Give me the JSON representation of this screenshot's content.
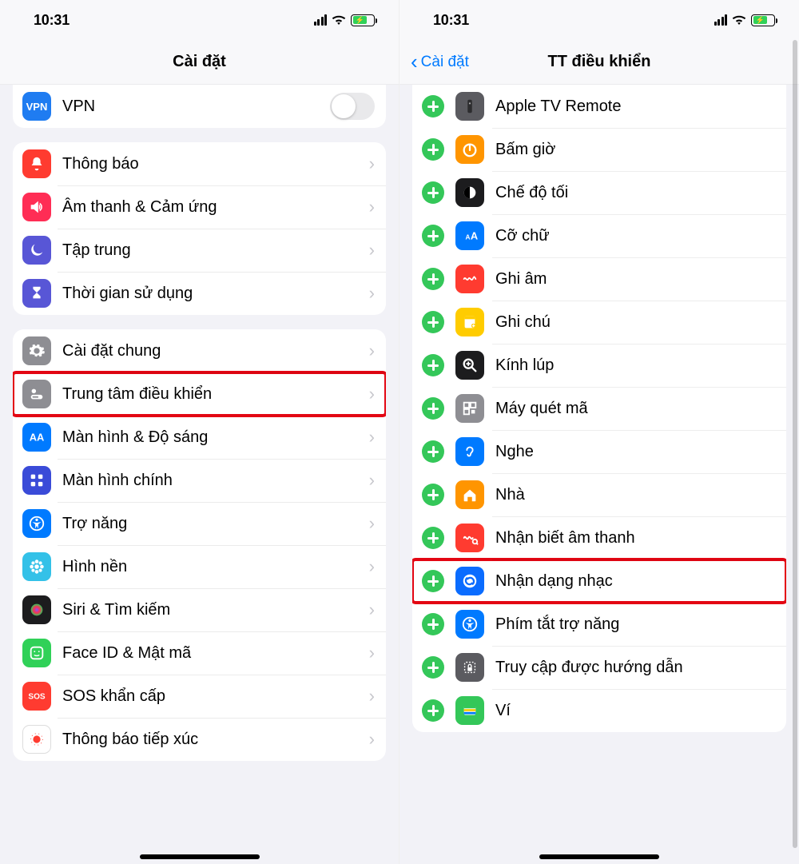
{
  "status": {
    "time": "10:31"
  },
  "left": {
    "title": "Cài đặt",
    "vpn": {
      "label": "VPN",
      "icon_bg": "#1f7cf1",
      "icon_text": "VPN"
    },
    "group2": [
      {
        "label": "Thông báo",
        "icon_bg": "#ff3b30",
        "icon": "bell"
      },
      {
        "label": "Âm thanh & Cảm ứng",
        "icon_bg": "#ff2d55",
        "icon": "speaker"
      },
      {
        "label": "Tập trung",
        "icon_bg": "#5856d6",
        "icon": "moon"
      },
      {
        "label": "Thời gian sử dụng",
        "icon_bg": "#5856d6",
        "icon": "hourglass"
      }
    ],
    "group3": [
      {
        "label": "Cài đặt chung",
        "icon_bg": "#8e8e93",
        "icon": "gear"
      },
      {
        "label": "Trung tâm điều khiển",
        "icon_bg": "#8e8e93",
        "icon": "switches",
        "highlight": true
      },
      {
        "label": "Màn hình & Độ sáng",
        "icon_bg": "#007aff",
        "icon": "aa"
      },
      {
        "label": "Màn hình chính",
        "icon_bg": "#3a4bd8",
        "icon": "gridapps"
      },
      {
        "label": "Trợ năng",
        "icon_bg": "#007aff",
        "icon": "accessibility"
      },
      {
        "label": "Hình nền",
        "icon_bg": "#33c1e8",
        "icon": "flower"
      },
      {
        "label": "Siri & Tìm kiếm",
        "icon_bg": "#1c1c1e",
        "icon": "siri"
      },
      {
        "label": "Face ID & Mật mã",
        "icon_bg": "#30d158",
        "icon": "faceid"
      },
      {
        "label": "SOS khẩn cấp",
        "icon_bg": "#ff3b30",
        "icon": "sos"
      },
      {
        "label": "Thông báo tiếp xúc",
        "icon_bg": "#ffffff",
        "icon": "exposure"
      }
    ]
  },
  "right": {
    "back_label": "Cài đặt",
    "title": "TT điều khiển",
    "controls": [
      {
        "label": "Apple TV Remote",
        "icon_bg": "#5b5b60",
        "icon": "remote"
      },
      {
        "label": "Bấm giờ",
        "icon_bg": "#ff9500",
        "icon": "timer"
      },
      {
        "label": "Chế độ tối",
        "icon_bg": "#1c1c1e",
        "icon": "darkmode"
      },
      {
        "label": "Cỡ chữ",
        "icon_bg": "#007aff",
        "icon": "aA"
      },
      {
        "label": "Ghi âm",
        "icon_bg": "#ff3b30",
        "icon": "voicememo"
      },
      {
        "label": "Ghi chú",
        "icon_bg": "#ffcc00",
        "icon": "notes"
      },
      {
        "label": "Kính lúp",
        "icon_bg": "#1c1c1e",
        "icon": "magnifier"
      },
      {
        "label": "Máy quét mã",
        "icon_bg": "#8e8e93",
        "icon": "qr"
      },
      {
        "label": "Nghe",
        "icon_bg": "#007aff",
        "icon": "ear"
      },
      {
        "label": "Nhà",
        "icon_bg": "#ff9500",
        "icon": "home"
      },
      {
        "label": "Nhận biết âm thanh",
        "icon_bg": "#ff3b30",
        "icon": "soundwave"
      },
      {
        "label": "Nhận dạng nhạc",
        "icon_bg": "#0a6cff",
        "icon": "shazam",
        "highlight": true
      },
      {
        "label": "Phím tắt trợ năng",
        "icon_bg": "#007aff",
        "icon": "accessibility"
      },
      {
        "label": "Truy cập được hướng dẫn",
        "icon_bg": "#5b5b60",
        "icon": "lockpad"
      },
      {
        "label": "Ví",
        "icon_bg": "#34c759",
        "icon": "wallet"
      }
    ]
  }
}
